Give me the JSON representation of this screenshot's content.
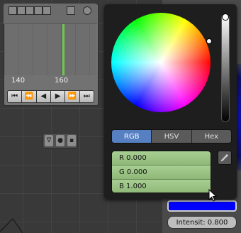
{
  "timeline": {
    "frame_labels": [
      "140",
      "160"
    ],
    "current_frame_color": "#6ec94a",
    "transport_buttons": [
      {
        "icon": "jump-start-icon",
        "glyph": "⏮"
      },
      {
        "icon": "jump-keyframe-back-icon",
        "glyph": "⏪"
      },
      {
        "icon": "play-reverse-icon",
        "glyph": "◀"
      },
      {
        "icon": "play-icon",
        "glyph": "▶"
      },
      {
        "icon": "jump-keyframe-forward-icon",
        "glyph": "⏩"
      },
      {
        "icon": "jump-end-icon",
        "glyph": "⏭"
      }
    ]
  },
  "color_picker": {
    "tabs": [
      {
        "label": "RGB",
        "active": true
      },
      {
        "label": "HSV",
        "active": false
      },
      {
        "label": "Hex",
        "active": false
      }
    ],
    "rows": [
      {
        "label": "R 0.000"
      },
      {
        "label": "G 0.000"
      },
      {
        "label": "B 1.000"
      }
    ],
    "current_color": "#0000ff"
  },
  "lamp": {
    "intensity_label": "Intensit: 0.800"
  }
}
